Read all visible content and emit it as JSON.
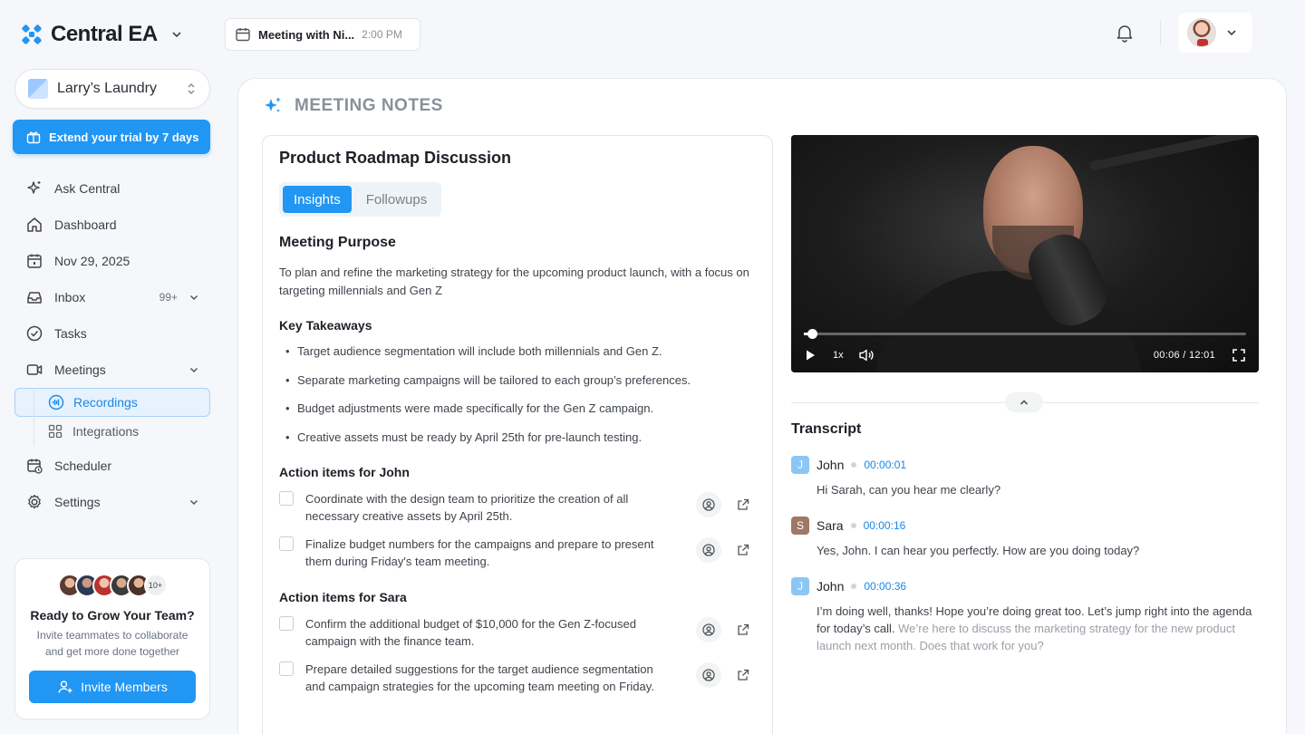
{
  "app": {
    "name": "Central EA"
  },
  "header": {
    "meeting_title": "Meeting with Ni...",
    "meeting_time": "2:00 PM"
  },
  "sidebar": {
    "workspace": "Larry’s Laundry",
    "trial_button": "Extend your trial by 7 days",
    "items": [
      {
        "label": "Ask Central",
        "icon": "sparkle-icon"
      },
      {
        "label": "Dashboard",
        "icon": "home-icon"
      },
      {
        "label": "Nov 29, 2025",
        "icon": "calendar-icon"
      },
      {
        "label": "Inbox",
        "icon": "inbox-icon",
        "badge": "99+"
      },
      {
        "label": "Tasks",
        "icon": "check-circle-icon"
      },
      {
        "label": "Meetings",
        "icon": "video-icon"
      }
    ],
    "sub_items": [
      {
        "label": "Recordings",
        "icon": "waveform-icon",
        "active": true
      },
      {
        "label": "Integrations",
        "icon": "grid-icon"
      }
    ],
    "bottom_items": [
      {
        "label": "Scheduler",
        "icon": "calendar-clock-icon"
      },
      {
        "label": "Settings",
        "icon": "gear-icon"
      }
    ],
    "grow_card": {
      "more_count": "10+",
      "title": "Ready to Grow Your Team?",
      "subtitle": "Invite teammates to collaborate and get more done together",
      "button": "Invite Members"
    }
  },
  "main": {
    "section_label": "MEETING NOTES",
    "notes": {
      "title": "Product Roadmap Discussion",
      "tabs": [
        "Insights",
        "Followups"
      ],
      "purpose_heading": "Meeting Purpose",
      "purpose_text": "To plan and refine the marketing strategy for the upcoming product launch, with a focus on targeting millennials and Gen Z",
      "takeaways_heading": "Key Takeaways",
      "takeaways": [
        "Target audience segmentation will include both millennials and Gen Z.",
        "Separate marketing campaigns will be tailored to each group’s preferences.",
        "Budget adjustments were made specifically for the Gen Z campaign.",
        "Creative assets must be ready by April 25th for pre-launch testing."
      ],
      "john_heading": "Action items for John",
      "john_items": [
        "Coordinate with the design team to prioritize the creation of all necessary creative assets by April 25th.",
        "Finalize budget numbers for the campaigns and prepare to present them during Friday's team meeting."
      ],
      "sara_heading": "Action items for Sara",
      "sara_items": [
        "Confirm the additional budget of $10,000 for the Gen Z-focused campaign with the finance team.",
        "Prepare detailed suggestions for the target audience segmentation and campaign strategies for the upcoming team meeting on Friday."
      ]
    },
    "video": {
      "speed": "1x",
      "time": "00:06 / 12:01",
      "progress": 0.008
    },
    "transcript": {
      "title": "Transcript",
      "entries": [
        {
          "initial": "J",
          "name": "John",
          "time": "00:00:01",
          "color": "#8cc6f5",
          "text": "Hi Sarah, can you hear me clearly?",
          "faded": ""
        },
        {
          "initial": "S",
          "name": "Sara",
          "time": "00:00:16",
          "color": "#a07866",
          "text": "Yes, John. I can hear you perfectly. How are you doing today?",
          "faded": ""
        },
        {
          "initial": "J",
          "name": "John",
          "time": "00:00:36",
          "color": "#8cc6f5",
          "text": "I’m doing well, thanks! Hope you’re doing great too. Let’s jump right into the agenda for today’s call. ",
          "faded": "We’re here to discuss the marketing strategy for the new product launch next month. Does that work for you?"
        }
      ]
    }
  },
  "colors": {
    "accent": "#2196f3",
    "accent_text": "#1b87e6"
  }
}
